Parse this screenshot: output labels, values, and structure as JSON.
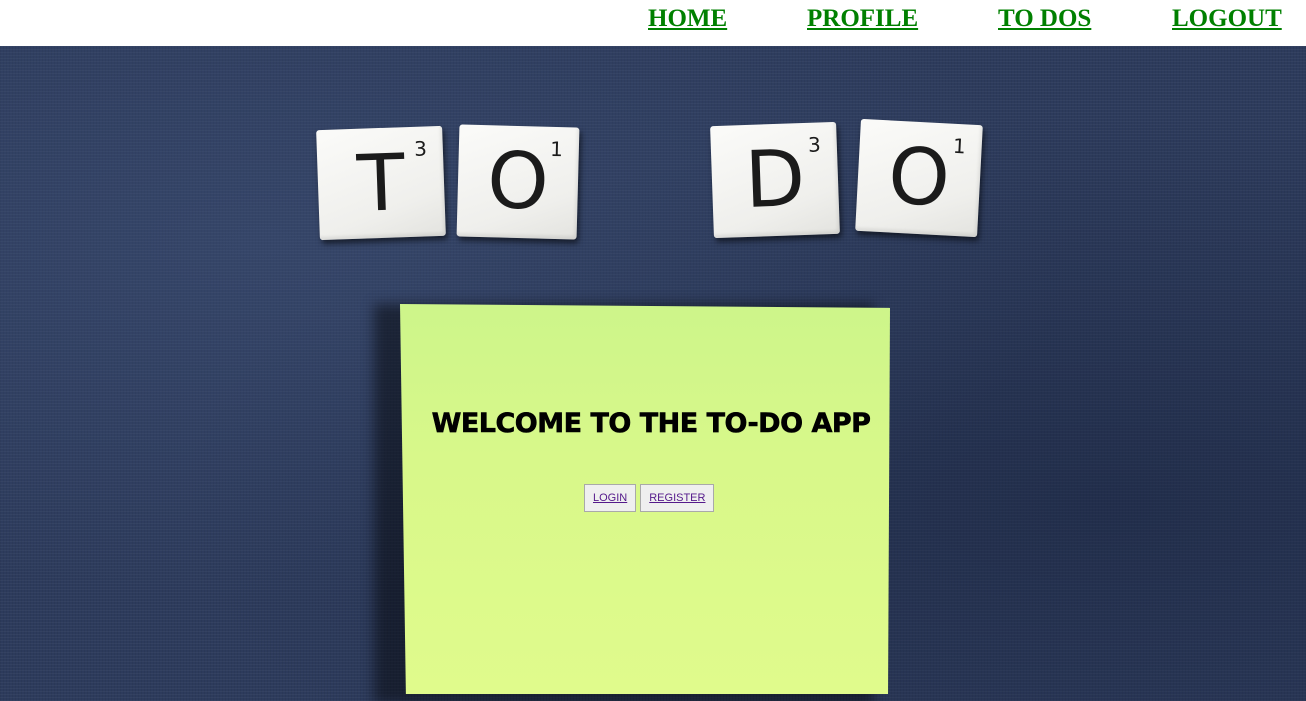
{
  "nav": {
    "home": "HOME",
    "profile": "PROFILE",
    "todos": "TO DOS",
    "logout": "LOGOUT",
    "link_color": "#008000"
  },
  "hero": {
    "tiles": [
      {
        "letter": "T",
        "score": "3"
      },
      {
        "letter": "O",
        "score": "1"
      },
      {
        "letter": "D",
        "score": "3"
      },
      {
        "letter": "O",
        "score": "1"
      }
    ],
    "background_color": "#2d3b5c"
  },
  "sticky": {
    "title": "WELCOME TO THE TO-DO APP",
    "login_label": "LOGIN",
    "register_label": "REGISTER",
    "note_color": "#d8f88a"
  }
}
